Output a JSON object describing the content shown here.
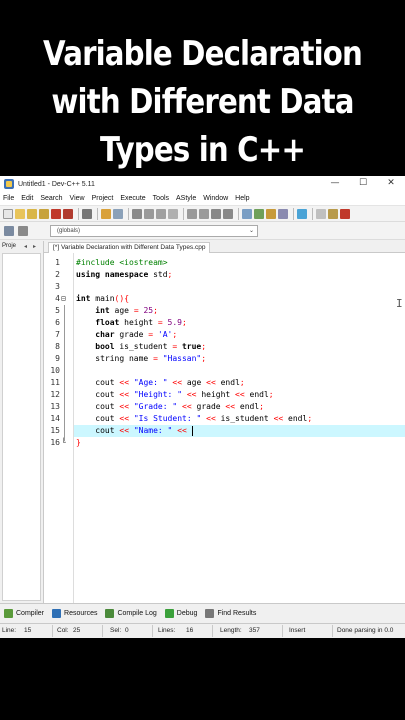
{
  "caption": {
    "line1": "Variable Declaration",
    "line2": "with Different Data",
    "line3": "Types in C++"
  },
  "window": {
    "title": "Untitled1 - Dev-C++ 5.11",
    "minimize": "—",
    "maximize": "☐",
    "close": "✕"
  },
  "menu": [
    "File",
    "Edit",
    "Search",
    "View",
    "Project",
    "Execute",
    "Tools",
    "AStyle",
    "Window",
    "Help"
  ],
  "scope": {
    "value": "(globals)"
  },
  "left_panel": {
    "tab": "Proje"
  },
  "editor": {
    "tab_label": "[*] Variable Declaration with Different Data Types.cpp",
    "line_numbers": [
      "1",
      "2",
      "3",
      "4",
      "5",
      "6",
      "7",
      "8",
      "9",
      "10",
      "11",
      "12",
      "13",
      "14",
      "15",
      "16"
    ],
    "current_line": 15,
    "lines": [
      "#include <iostream>",
      "using namespace std;",
      "",
      "int main(){",
      "    int age = 25;",
      "    float height = 5.9;",
      "    char grade = 'A';",
      "    bool is_student = true;",
      "    string name = \"Hassan\";",
      "",
      "    cout << \"Age: \" << age << endl;",
      "    cout << \"Height: \" << height << endl;",
      "    cout << \"Grade: \" << grade << endl;",
      "    cout << \"Is Student: \" << is_student << endl;",
      "    cout << \"Name: \" <<",
      "}"
    ]
  },
  "bottom_tabs": [
    {
      "label": "Compiler",
      "icon": "compiler-icon",
      "color": "#5a9a3a"
    },
    {
      "label": "Resources",
      "icon": "resources-icon",
      "color": "#2e6fb5"
    },
    {
      "label": "Compile Log",
      "icon": "compile-log-icon",
      "color": "#4a8a3a"
    },
    {
      "label": "Debug",
      "icon": "debug-icon",
      "color": "#3aa03a"
    },
    {
      "label": "Find Results",
      "icon": "find-results-icon",
      "color": "#777777"
    }
  ],
  "status": {
    "line_label": "Line:",
    "line_value": "15",
    "col_label": "Col:",
    "col_value": "25",
    "sel_label": "Sel:",
    "sel_value": "0",
    "lines_label": "Lines:",
    "lines_value": "16",
    "length_label": "Length:",
    "length_value": "357",
    "mode": "Insert",
    "message": "Done parsing in 0.0"
  },
  "colors": {
    "keyword": "#000000",
    "preprocessor": "#008000",
    "string": "#0000ff",
    "operator": "#ff0000",
    "number": "#800080",
    "current_line_bg": "#ccf7ff"
  }
}
